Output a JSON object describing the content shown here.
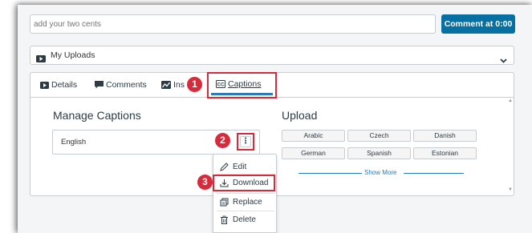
{
  "comment": {
    "placeholder": "add your two cents",
    "button_label": "Comment at 0:00"
  },
  "uploads": {
    "label": "My Uploads"
  },
  "tabs": [
    {
      "label": "Details",
      "icon": "video-icon"
    },
    {
      "label": "Comments",
      "icon": "comment-icon"
    },
    {
      "label": "Ins",
      "icon": "insights-icon"
    },
    {
      "label": "Captions",
      "icon": "cc-icon",
      "active": true
    }
  ],
  "manage": {
    "heading": "Manage Captions",
    "captions": [
      "English"
    ]
  },
  "upload": {
    "heading": "Upload",
    "languages": [
      "Arabic",
      "Czech",
      "Danish",
      "German",
      "Spanish",
      "Estonian"
    ],
    "show_more": "Show More"
  },
  "menu": {
    "items": [
      {
        "label": "Edit",
        "icon": "pencil-icon"
      },
      {
        "label": "Download",
        "icon": "download-icon"
      },
      {
        "label": "Replace",
        "icon": "replace-icon"
      },
      {
        "label": "Delete",
        "icon": "trash-icon"
      }
    ]
  },
  "badges": [
    "1",
    "2",
    "3"
  ],
  "colors": {
    "accent": "#0770a3",
    "highlight": "#d52b3a",
    "link": "#2b7abc"
  }
}
